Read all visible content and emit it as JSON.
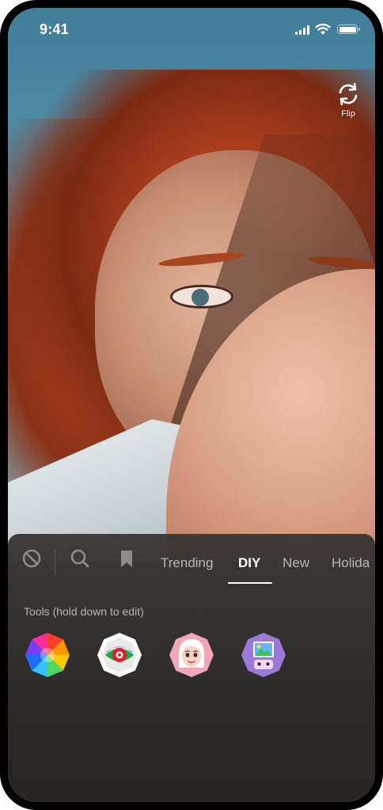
{
  "status_bar": {
    "time": "9:41"
  },
  "camera": {
    "flip_label": "Flip"
  },
  "effects_panel": {
    "tabs": [
      {
        "label": "Trending",
        "active": false
      },
      {
        "label": "DIY",
        "active": true
      },
      {
        "label": "New",
        "active": false
      },
      {
        "label": "Holida",
        "active": false
      }
    ],
    "icons": [
      "no-effect-icon",
      "search-icon",
      "bookmark-icon"
    ],
    "section_label": "Tools (hold down to edit)",
    "tools": [
      {
        "name": "color-wheel-tool",
        "icon": "color-wheel-icon"
      },
      {
        "name": "eye-tool",
        "icon": "eye-icon"
      },
      {
        "name": "face-tool",
        "icon": "face-icon"
      },
      {
        "name": "image-tool",
        "icon": "image-icon"
      }
    ]
  },
  "colors": {
    "panel_bg": "#2d2b2a",
    "tab_active": "#ffffff",
    "tab_inactive": "#b9b6b3"
  }
}
